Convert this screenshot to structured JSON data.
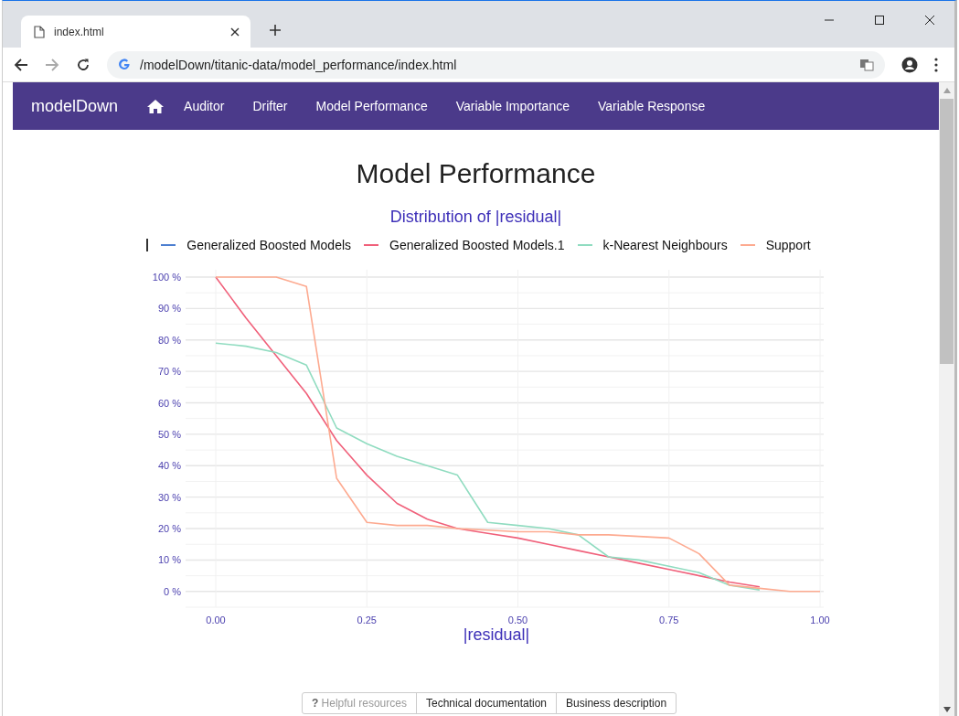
{
  "browser": {
    "tab_title": "index.html",
    "address": "/modelDown/titanic-data/model_performance/index.html"
  },
  "navbar": {
    "brand": "modelDown",
    "items": [
      {
        "label": "Auditor"
      },
      {
        "label": "Drifter"
      },
      {
        "label": "Model Performance"
      },
      {
        "label": "Variable Importance"
      },
      {
        "label": "Variable Response"
      }
    ]
  },
  "page": {
    "title": "Model Performance",
    "chart_title": "Distribution of |residual|",
    "chart_data": {
      "type": "line",
      "grid": true,
      "xlabel": "|residual|",
      "x": [
        0,
        0.05,
        0.1,
        0.15,
        0.2,
        0.25,
        0.3,
        0.35,
        0.4,
        0.45,
        0.5,
        0.55,
        0.6,
        0.65,
        0.7,
        0.75,
        0.8,
        0.85,
        0.9,
        0.95,
        1
      ],
      "series": [
        {
          "name": "Generalized Boosted Models",
          "color": "#4c7fd0",
          "values": [
            null,
            null,
            null,
            null,
            null,
            null,
            null,
            null,
            null,
            null,
            null,
            null,
            null,
            null,
            null,
            null,
            null,
            null,
            null,
            null,
            null
          ]
        },
        {
          "name": "Generalized Boosted Models.1",
          "color": "#f0607a",
          "values": [
            100,
            87,
            75,
            63,
            48,
            37,
            28,
            23,
            20,
            18.5,
            17,
            15,
            13,
            11,
            9,
            7,
            5,
            3,
            1.5,
            null,
            null
          ]
        },
        {
          "name": "k-Nearest Neighbours",
          "color": "#90dcc0",
          "values": [
            79,
            78,
            76,
            72,
            52,
            47,
            43,
            40,
            37,
            22,
            21,
            20,
            18,
            11,
            10,
            8,
            6,
            2,
            0.5,
            null,
            null
          ]
        },
        {
          "name": "Support",
          "color": "#fdaa90",
          "values": [
            100,
            100,
            100,
            97,
            36,
            22,
            21,
            21,
            20,
            19.5,
            19,
            19,
            18,
            18,
            17.5,
            17,
            12,
            2,
            1,
            0,
            0
          ]
        }
      ],
      "xlim": [
        -0.05,
        1
      ],
      "ylim": [
        -5,
        100
      ],
      "xticks": [
        {
          "value": 0,
          "label": "0.00"
        },
        {
          "value": 0.25,
          "label": "0.25"
        },
        {
          "value": 0.5,
          "label": "0.50"
        },
        {
          "value": 0.75,
          "label": "0.75"
        },
        {
          "value": 1,
          "label": "1.00"
        }
      ],
      "yticks": [
        {
          "value": 0,
          "label": "0 %"
        },
        {
          "value": 10,
          "label": "10 %"
        },
        {
          "value": 20,
          "label": "20 %"
        },
        {
          "value": 30,
          "label": "30 %"
        },
        {
          "value": 40,
          "label": "40 %"
        },
        {
          "value": 50,
          "label": "50 %"
        },
        {
          "value": 60,
          "label": "60 %"
        },
        {
          "value": 70,
          "label": "70 %"
        },
        {
          "value": 80,
          "label": "80 %"
        },
        {
          "value": 90,
          "label": "90 %"
        },
        {
          "value": 100,
          "label": "100 %"
        }
      ]
    },
    "footer_buttons": [
      {
        "label": "Helpful resources",
        "icon": "?",
        "kind": "label"
      },
      {
        "label": "Technical documentation",
        "kind": "button"
      },
      {
        "label": "Business description",
        "kind": "button"
      }
    ]
  }
}
